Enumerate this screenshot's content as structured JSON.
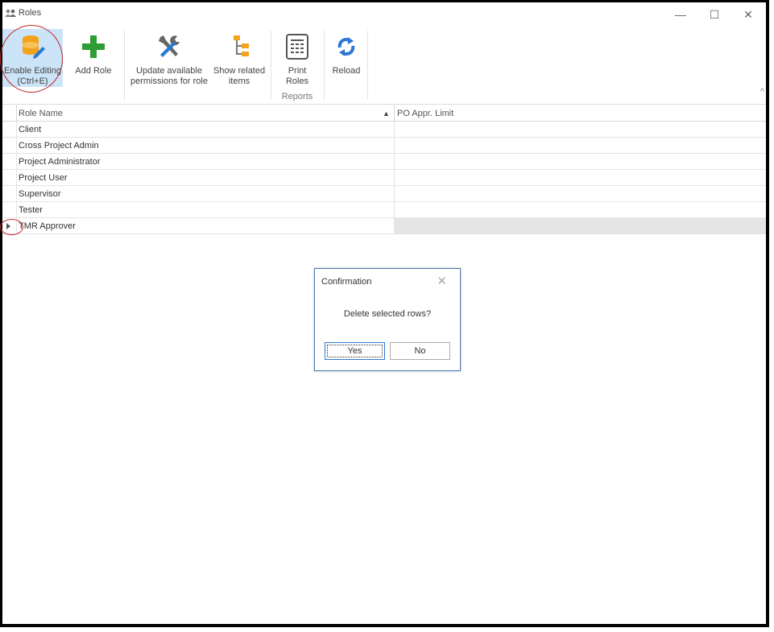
{
  "window": {
    "title": "Roles",
    "minimize": "—",
    "maximize": "☐",
    "close": "✕"
  },
  "ribbon": {
    "buttons": [
      {
        "label_line1": "Enable Editing",
        "label_line2": "(Ctrl+E)",
        "icon": "database-edit-icon",
        "active": true
      },
      {
        "label_line1": "Add Role",
        "label_line2": "",
        "icon": "plus-icon"
      },
      {
        "label_line1": "Update available",
        "label_line2": "permissions for role",
        "icon": "tools-icon"
      },
      {
        "label_line1": "Show related",
        "label_line2": "items",
        "icon": "tree-icon"
      },
      {
        "label_line1": "Print",
        "label_line2": "Roles",
        "icon": "print-icon"
      },
      {
        "label_line1": "Reload",
        "label_line2": "",
        "icon": "reload-icon"
      }
    ],
    "group_reports": "Reports",
    "collapse": "^"
  },
  "grid": {
    "columns": [
      "Role Name",
      "PO Appr. Limit"
    ],
    "sort_glyph": "▲",
    "rows": [
      {
        "name": "Client",
        "limit": ""
      },
      {
        "name": "Cross Project Admin",
        "limit": ""
      },
      {
        "name": "Project Administrator",
        "limit": ""
      },
      {
        "name": "Project User",
        "limit": ""
      },
      {
        "name": "Supervisor",
        "limit": ""
      },
      {
        "name": "Tester",
        "limit": ""
      },
      {
        "name": "TMR Approver",
        "limit": "",
        "selected": true
      }
    ]
  },
  "dialog": {
    "title": "Confirmation",
    "message": "Delete selected rows?",
    "yes": "Yes",
    "no": "No",
    "close": "✕"
  },
  "colors": {
    "accent": "#2b78d4",
    "annotation": "#c0282d",
    "active_button": "#cce4f7"
  }
}
